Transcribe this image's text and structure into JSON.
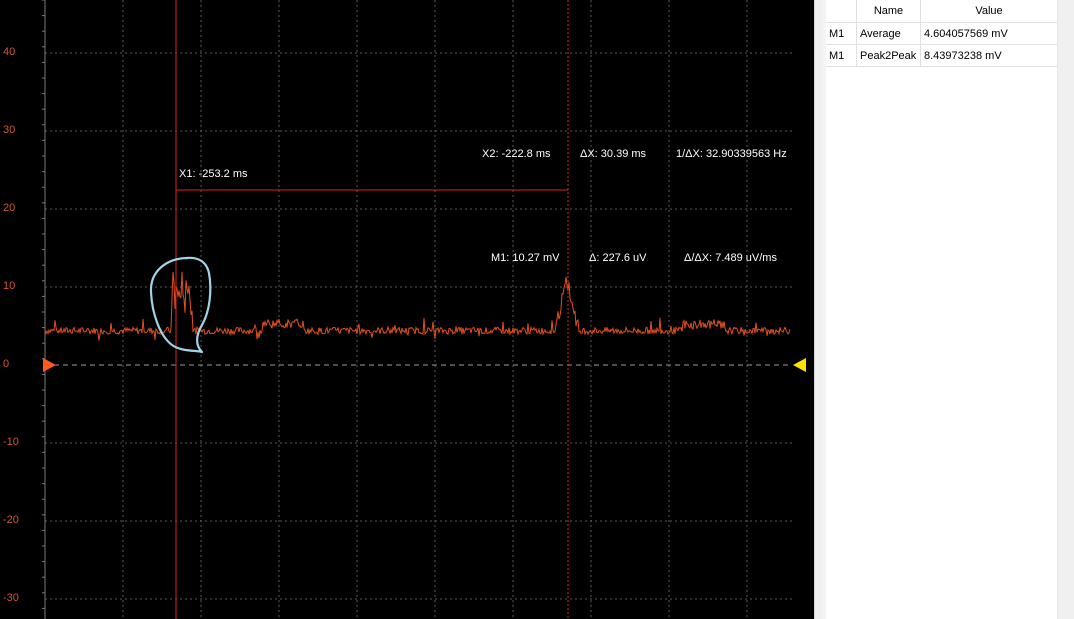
{
  "scope": {
    "y_axis_labels": [
      {
        "value": 40,
        "text": "40"
      },
      {
        "value": 30,
        "text": "30"
      },
      {
        "value": 20,
        "text": "20"
      },
      {
        "value": 10,
        "text": "10"
      },
      {
        "value": 0,
        "text": "0"
      },
      {
        "value": -10,
        "text": "-10"
      },
      {
        "value": -20,
        "text": "-20"
      },
      {
        "value": -30,
        "text": "-30"
      }
    ],
    "colors": {
      "background": "#000000",
      "grid": "#5a5a5a",
      "trace": "#e0501e",
      "cursor": "#e02020",
      "annotation": "#9fd3e6",
      "left_marker": "#ff5a1a",
      "right_marker": "#ffe200",
      "axis_text": "#d1553a"
    },
    "readouts": {
      "x1": "X1: -253.2 ms",
      "x2": "X2: -222.8 ms",
      "delta_x": "ΔX: 30.39 ms",
      "inv_delta_x": "1/ΔX: 32.90339563 Hz",
      "m1": "M1: 10.27 mV",
      "delta": "Δ: 227.6 uV",
      "slope": "Δ/ΔX: 7.489 uV/ms"
    }
  },
  "measurements": {
    "headers": [
      "",
      "Name",
      "Value"
    ],
    "rows": [
      {
        "source": "M1",
        "name": "Average",
        "value": "4.604057569 mV"
      },
      {
        "source": "M1",
        "name": "Peak2Peak",
        "value": "8.43973238 mV"
      }
    ]
  }
}
